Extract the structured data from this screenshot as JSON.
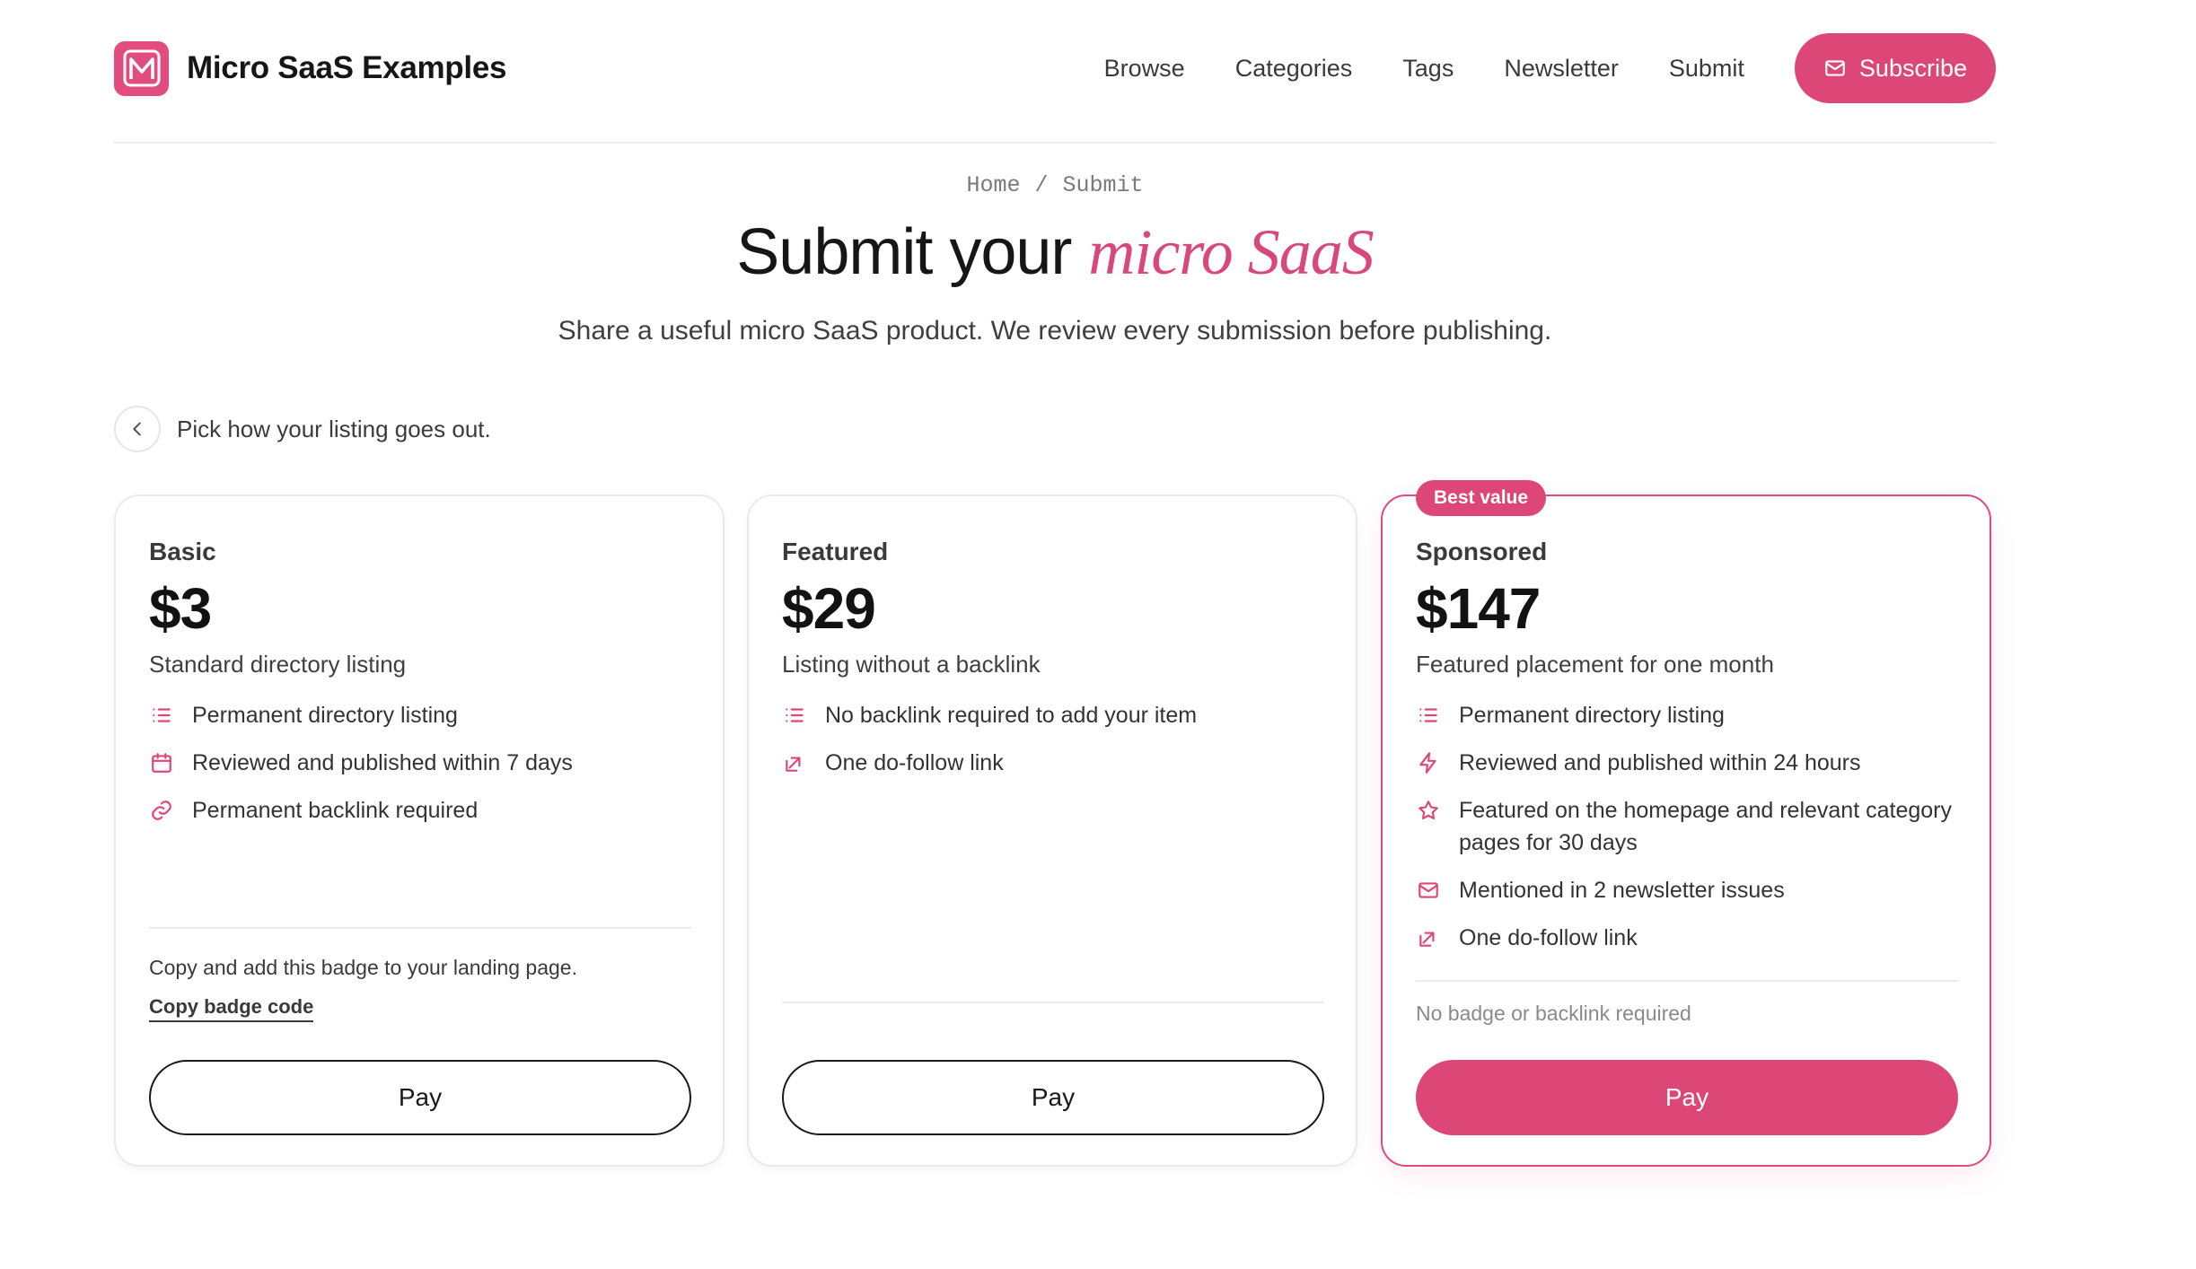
{
  "header": {
    "brand_name": "Micro SaaS Examples",
    "nav": [
      "Browse",
      "Categories",
      "Tags",
      "Newsletter",
      "Submit"
    ],
    "subscribe_label": "Subscribe"
  },
  "breadcrumb": {
    "home": "Home",
    "separator": "/",
    "current": "Submit"
  },
  "hero": {
    "title_main": "Submit your",
    "title_accent": "micro SaaS",
    "subtitle": "Share a useful micro SaaS product. We review every submission before publishing."
  },
  "back": {
    "text": "Pick how your listing goes out."
  },
  "plans": [
    {
      "name": "Basic",
      "price": "$3",
      "description": "Standard directory listing",
      "features": [
        {
          "icon": "list-icon",
          "text": "Permanent directory listing"
        },
        {
          "icon": "calendar-icon",
          "text": "Reviewed and published within 7 days"
        },
        {
          "icon": "link-icon",
          "text": "Permanent backlink required"
        }
      ],
      "badge_note": "Copy and add this badge to your landing page.",
      "badge_link": "Copy badge code",
      "pay_label": "Pay"
    },
    {
      "name": "Featured",
      "price": "$29",
      "description": "Listing without a backlink",
      "features": [
        {
          "icon": "list-icon",
          "text": "No backlink required to add your item"
        },
        {
          "icon": "external-link-icon",
          "text": "One do-follow link"
        }
      ],
      "pay_label": "Pay"
    },
    {
      "name": "Sponsored",
      "badge": "Best value",
      "price": "$147",
      "description": "Featured placement for one month",
      "features": [
        {
          "icon": "list-icon",
          "text": "Permanent directory listing"
        },
        {
          "icon": "lightning-icon",
          "text": "Reviewed and published within 24 hours"
        },
        {
          "icon": "star-icon",
          "text": "Featured on the homepage and relevant category pages for 30 days"
        },
        {
          "icon": "mail-icon",
          "text": "Mentioned in 2 newsletter issues"
        },
        {
          "icon": "external-link-icon",
          "text": "One do-follow link"
        }
      ],
      "footer_note": "No badge or backlink required",
      "pay_label": "Pay"
    }
  ],
  "colors": {
    "accent": "#dd4778",
    "text": "#1f1f1f",
    "muted": "#8a8a8a",
    "border": "#eaeaea"
  }
}
